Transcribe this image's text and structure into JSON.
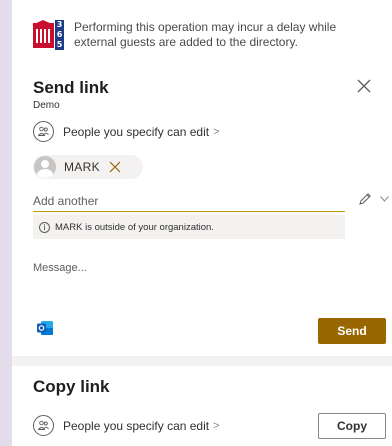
{
  "notice": {
    "text": "Performing this operation may incur a delay while external guests are added to the directory.",
    "logo_digits": [
      "3",
      "6",
      "5"
    ]
  },
  "send_link": {
    "title": "Send link",
    "subtitle": "Demo",
    "permission_label": "People you specify can edit",
    "chevron": ">",
    "recipient": {
      "name": "MARK"
    },
    "add_placeholder": "Add another",
    "warning_text": "MARK is outside of your organization.",
    "message_placeholder": "Message...",
    "send_label": "Send"
  },
  "copy_link": {
    "title": "Copy link",
    "permission_label": "People you specify can edit",
    "chevron": ">",
    "copy_label": "Copy"
  },
  "colors": {
    "accent": "#996600",
    "input_underline": "#c19c00",
    "background": "#e4dcea"
  }
}
